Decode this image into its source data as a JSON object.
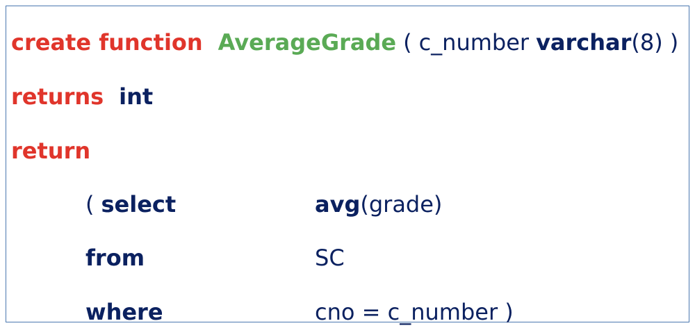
{
  "code": {
    "line1": {
      "kw_create": "create function",
      "fn_name": "AverageGrade",
      "open_paren": "(",
      "param_name": "c_number",
      "param_type": "varchar",
      "param_size": "(8)",
      "close_paren": ")"
    },
    "line2": {
      "kw_returns": "returns",
      "ret_type": "int"
    },
    "line3": {
      "kw_return": "return"
    },
    "line4": {
      "open_paren": "(",
      "kw_select": "select",
      "fn_avg": "avg",
      "avg_arg": "(grade)"
    },
    "line5": {
      "kw_from": "from",
      "table": "SC"
    },
    "line6": {
      "kw_where": "where",
      "condition": "cno = c_number )"
    }
  },
  "colors": {
    "keyword_red": "#e0352b",
    "function_green": "#5aaa55",
    "text_navy": "#0b2160",
    "border_blue": "#4a78b0"
  }
}
